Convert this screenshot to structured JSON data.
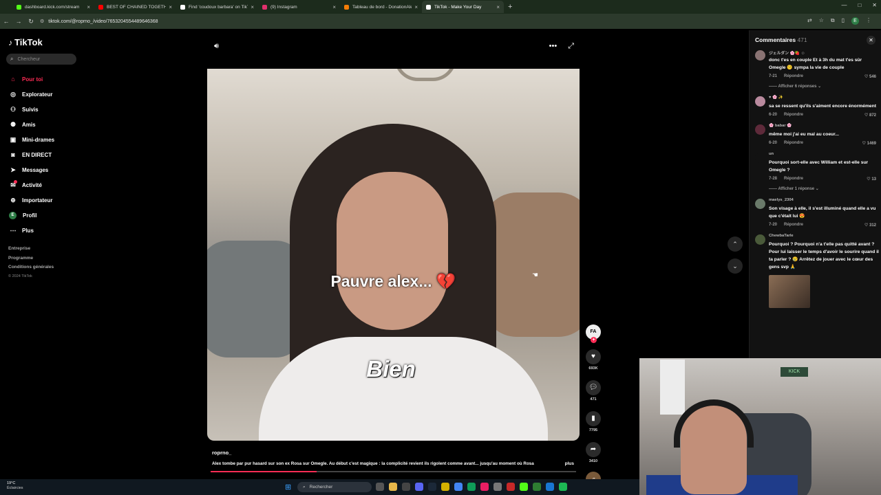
{
  "browser": {
    "tabs": [
      {
        "title": "dashboard.kick.com/stream",
        "color": "#53fc18",
        "active": false
      },
      {
        "title": "BEST OF CHAINED TOGETHER ...",
        "color": "#ff0000",
        "active": false
      },
      {
        "title": "Find 'coudoux barbara' on TikTok",
        "color": "#ffffff",
        "active": false
      },
      {
        "title": "(9) Instagram",
        "color": "#e1306c",
        "active": false
      },
      {
        "title": "Tableau de bord - DonationAlerts",
        "color": "#f57d07",
        "active": false
      },
      {
        "title": "TikTok - Make Your Day",
        "color": "#ffffff",
        "active": true
      }
    ],
    "url": "tiktok.com/@roprno_/video/7653204554489646368",
    "profile_initial": "E"
  },
  "sidebar": {
    "logo": "TikTok",
    "search_placeholder": "Chercheur",
    "items": [
      {
        "label": "Pour toi",
        "icon": "home-icon",
        "active": true
      },
      {
        "label": "Explorateur",
        "icon": "compass-icon",
        "active": false
      },
      {
        "label": "Suivis",
        "icon": "following-icon",
        "active": false
      },
      {
        "label": "Amis",
        "icon": "friends-icon",
        "active": false
      },
      {
        "label": "Mini-drames",
        "icon": "film-icon",
        "active": false
      },
      {
        "label": "EN DIRECT",
        "icon": "live-icon",
        "active": false
      },
      {
        "label": "Messages",
        "icon": "send-icon",
        "active": false
      },
      {
        "label": "Activité",
        "icon": "activity-icon",
        "active": false
      },
      {
        "label": "Importateur",
        "icon": "upload-icon",
        "active": false
      },
      {
        "label": "Profil",
        "icon": "profile-avatar",
        "active": false
      },
      {
        "label": "Plus",
        "icon": "more-icon",
        "active": false
      }
    ],
    "profile_initial": "E",
    "footer": [
      "Entreprise",
      "Programme",
      "Conditions générales"
    ],
    "copyright": "© 2024 TikTok"
  },
  "video": {
    "caption_top": "Pauvre alex...",
    "caption_heart": "💔",
    "caption_bottom": "Bien",
    "author": "roprno_",
    "description": "Alex tombe par pur hasard sur son ex Rosa sur Omegle. Au début c'est magique : la complicité revient ils rigolent comme avant... jusqu'au moment où Rosa",
    "more_label": "plus",
    "progress_fraction": 0.29
  },
  "actions": {
    "creator_label": "FA",
    "likes": "693K",
    "comments": "471",
    "saves": "7795",
    "shares": "3410"
  },
  "comments": {
    "title": "Commentaires",
    "count": "471",
    "items": [
      {
        "user": "ジェルダン 🌸🍓 ☺",
        "text": "donc t'es en couple Et à 3h du mat t'es sûr Omegle 😕 sympa la vie de couple",
        "date": "7-21",
        "reply": "Répondre",
        "likes": "546",
        "replies": "Afficher 6 réponses",
        "avatar": "#8a7373"
      },
      {
        "user": "♥ 🌸 ✨",
        "text": "sa se ressent qu'ils s'aiment encore énormément",
        "date": "6-20",
        "reply": "Répondre",
        "likes": "872",
        "replies": "",
        "avatar": "#b98a9e"
      },
      {
        "user": "🌸 babar 🌸",
        "text": "même moi j'ai eu mal au coeur...",
        "date": "6-20",
        "reply": "Répondre",
        "likes": "1469",
        "replies": "",
        "avatar": "#5e2a3a"
      },
      {
        "user": "un",
        "text": "Pourquoi sort-elle avec William et est-elle sur Omegle ?",
        "date": "7-28",
        "reply": "Répondre",
        "likes": "13",
        "replies": "Afficher 1 réponse",
        "avatar": "#121212"
      },
      {
        "user": "maelys_2304",
        "text": "Son visage à elle, il s'est illuminé quand elle a vu que c'était lui 😍",
        "date": "7-20",
        "reply": "Répondre",
        "likes": "312",
        "replies": "",
        "avatar": "#6a7a6a"
      },
      {
        "user": "ChewbaTarle",
        "text": "Pourquoi ? Pourquoi n'a t'elle pas quitté avant ? Pour lui laisser le temps d'avoir le sourire quand il ta parler ? 😢 Arrêtez de jouer avec le cœur des gens svp 🙏",
        "date": "",
        "reply": "",
        "likes": "",
        "replies": "",
        "avatar": "#4a5a3a"
      }
    ]
  },
  "webcam": {
    "badge": "KICK"
  },
  "taskbar": {
    "temp": "19°C",
    "weather": "Éclaircies",
    "search_placeholder": "Rechercher"
  },
  "colors": {
    "accent": "#fe2c55",
    "kick": "#53fc18"
  }
}
